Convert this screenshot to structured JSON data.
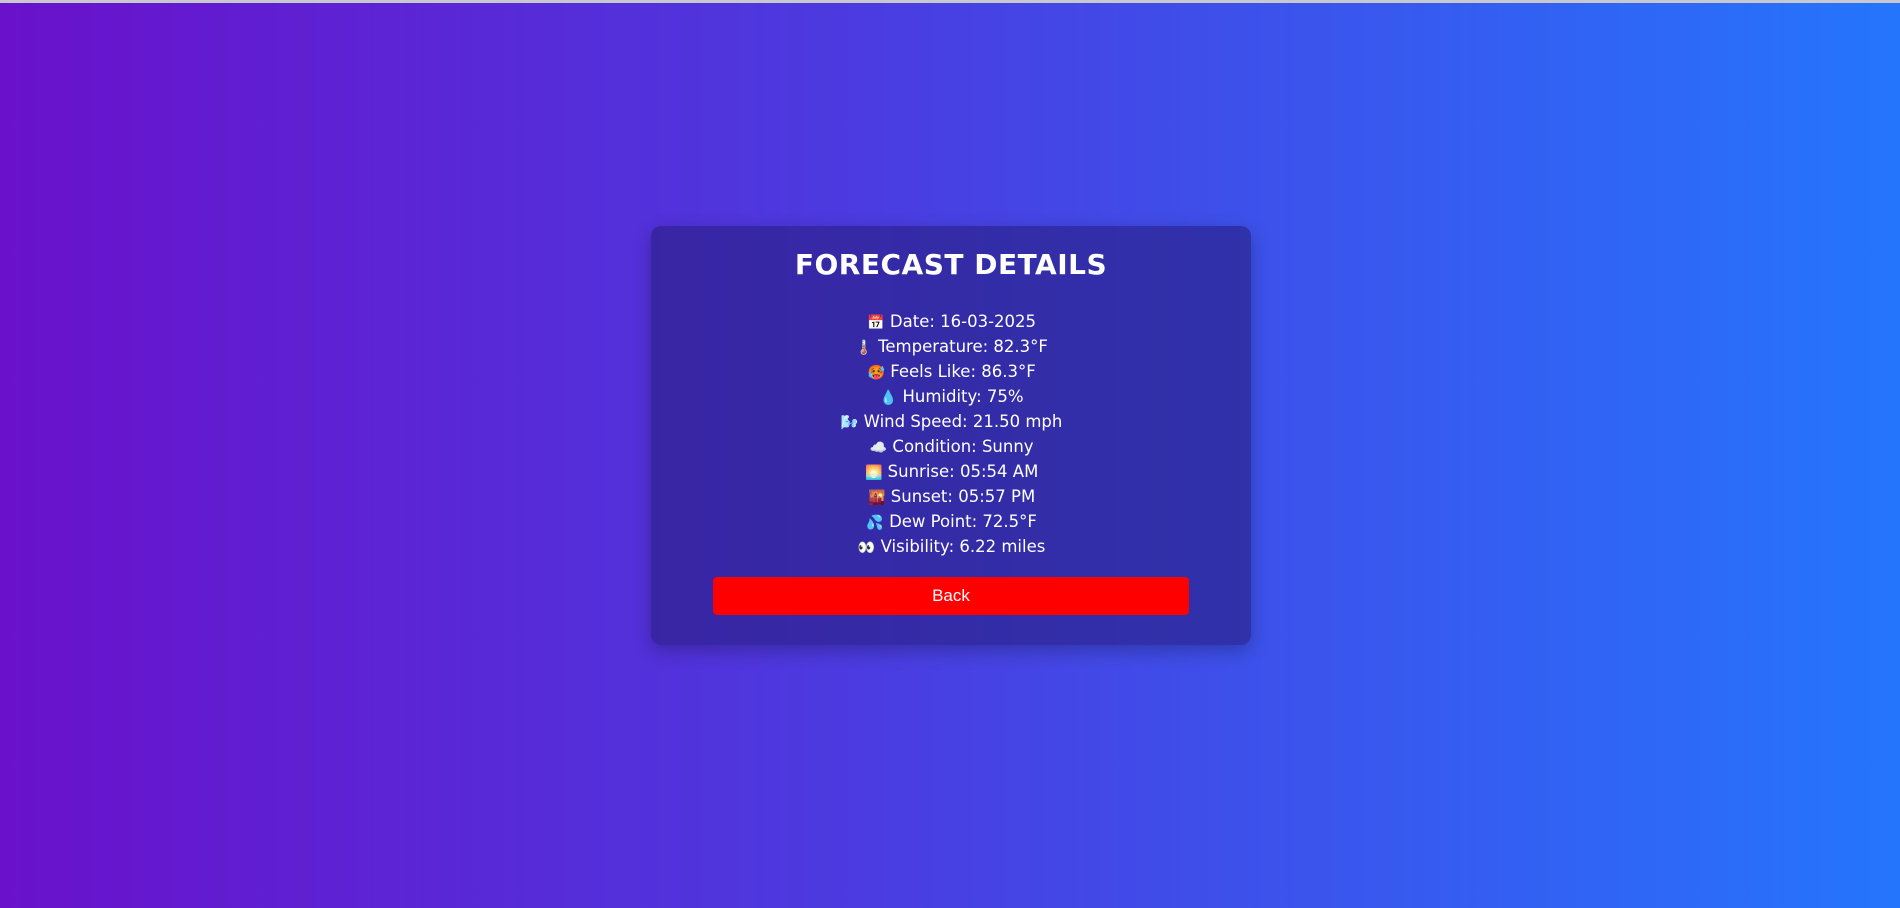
{
  "card": {
    "title": "FORECAST DETAILS",
    "details": [
      {
        "icon": "calendar-icon",
        "glyph": "📅",
        "text": "Date: 16-03-2025"
      },
      {
        "icon": "thermometer-icon",
        "glyph": "🌡️",
        "text": "Temperature: 82.3°F"
      },
      {
        "icon": "hot-face-icon",
        "glyph": "🥵",
        "text": "Feels Like: 86.3°F"
      },
      {
        "icon": "droplet-icon",
        "glyph": "💧",
        "text": "Humidity: 75%"
      },
      {
        "icon": "wind-icon",
        "glyph": "🌬️",
        "text": "Wind Speed: 21.50 mph"
      },
      {
        "icon": "cloud-icon",
        "glyph": "☁️",
        "text": "Condition: Sunny"
      },
      {
        "icon": "sunrise-icon",
        "glyph": "🌅",
        "text": "Sunrise: 05:54 AM"
      },
      {
        "icon": "sunset-icon",
        "glyph": "🌇",
        "text": "Sunset: 05:57 PM"
      },
      {
        "icon": "sweat-droplets-icon",
        "glyph": "💦",
        "text": "Dew Point: 72.5°F"
      },
      {
        "icon": "eyes-icon",
        "glyph": "👀",
        "text": "Visibility: 6.22 miles"
      }
    ],
    "back_label": "Back"
  },
  "colors": {
    "gradient_start": "#6a11cb",
    "gradient_end": "#2575fc",
    "button": "#ff0000"
  }
}
